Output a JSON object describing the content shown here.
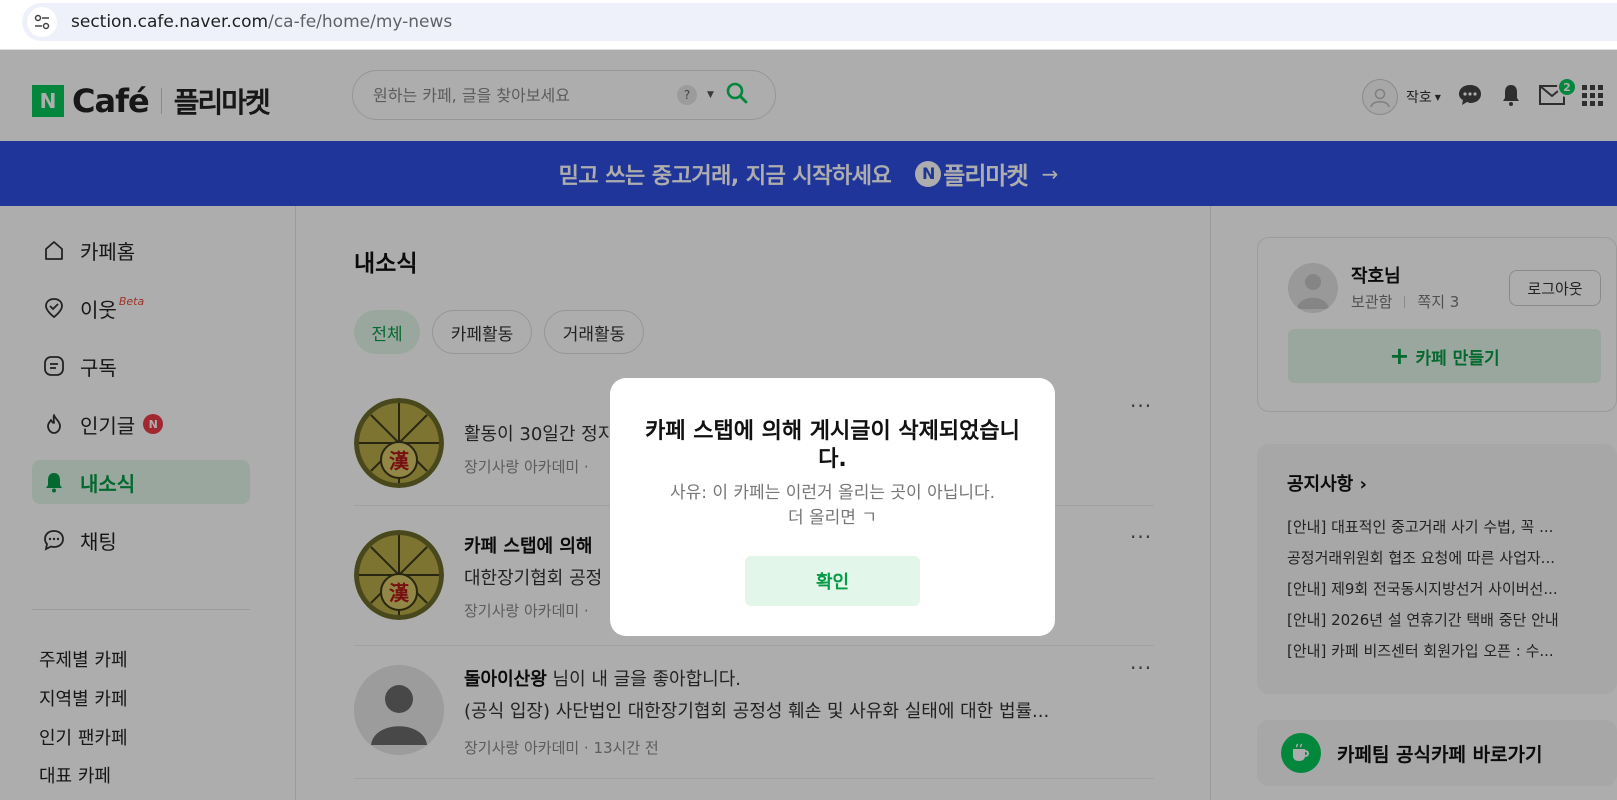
{
  "browser": {
    "url_host": "section.cafe.naver.com",
    "url_path": "/ca-fe/home/my-news"
  },
  "header": {
    "logo_n": "N",
    "logo_cafe": "Café",
    "logo_market": "플리마켓",
    "search_placeholder": "원하는 카페, 글을 찾아보세요",
    "help_label": "?",
    "username": "작호",
    "mail_count": "2"
  },
  "banner": {
    "text": "믿고 쓰는 중고거래, 지금 시작하세요",
    "logo_n": "N",
    "logo_text": "플리마켓",
    "arrow": "→"
  },
  "sidebar": {
    "items": [
      {
        "label": "카페홈",
        "icon": "home-icon"
      },
      {
        "label": "이웃",
        "icon": "check-badge-icon",
        "badge": "Beta"
      },
      {
        "label": "구독",
        "icon": "list-icon"
      },
      {
        "label": "인기글",
        "icon": "flame-icon",
        "badge": "N"
      },
      {
        "label": "내소식",
        "icon": "bell-icon",
        "active": true
      },
      {
        "label": "채팅",
        "icon": "chat-icon"
      }
    ],
    "links": [
      "주제별 카페",
      "지역별 카페",
      "인기 팬카페",
      "대표 카페"
    ]
  },
  "main": {
    "title": "내소식",
    "filters": [
      "전체",
      "카페활동",
      "거래활동"
    ],
    "feed": [
      {
        "line1": "활동이 30일간 정지",
        "meta": "장기사랑 아카데미 ·"
      },
      {
        "line1_bold": "카페 스탭에 의해",
        "line2": "대한장기협회 공정",
        "meta": "장기사랑 아카데미 ·"
      },
      {
        "line1_bold": "돌아이산왕",
        "line1_rest": " 님이 내 글을 좋아합니다.",
        "line2": "(공식 입장) 사단법인 대한장기협회 공정성 훼손 및 사유화 실태에 대한 법률...",
        "meta": "장기사랑 아카데미 · 13시간 전"
      }
    ],
    "more_label": "···"
  },
  "profile": {
    "name": "작호님",
    "storage": "보관함",
    "notes": "쪽지 3",
    "logout": "로그아웃",
    "make_cafe": "카페 만들기",
    "make_cafe_plus": "+"
  },
  "notices": {
    "title": "공지사항 ›",
    "items": [
      "[안내] 대표적인 중고거래 사기 수법, 꼭 ...",
      "공정거래위원회 협조 요청에 따른 사업자...",
      "[안내] 제9회 전국동시지방선거 사이버선...",
      "[안내] 2026년 설 연휴기간 택배 중단 안내",
      "[안내] 카페 비즈센터 회원가입 오픈 : 수..."
    ]
  },
  "official": {
    "label": "카페팀 공식카페 바로가기"
  },
  "dialog": {
    "title": "카페 스탭에 의해 게시글이 삭제되었습니다.",
    "message_line1": "사유: 이 카페는 이런거 올리는 곳이 아닙니다.",
    "message_line2": "더 올리면 ㄱ",
    "ok_label": "확인"
  },
  "colors": {
    "brand_green": "#03c75a",
    "active_green": "#079b45",
    "banner_blue": "#2f4fe3",
    "badge_red": "#ef3b47"
  }
}
